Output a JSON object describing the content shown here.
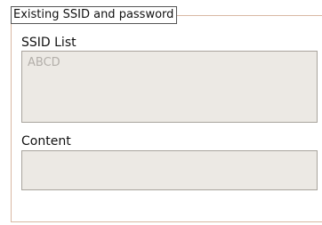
{
  "group": {
    "title": "Existing SSID and password"
  },
  "ssid_list": {
    "label": "SSID List",
    "items": [
      "ABCD"
    ]
  },
  "content": {
    "label": "Content",
    "value": ""
  }
}
